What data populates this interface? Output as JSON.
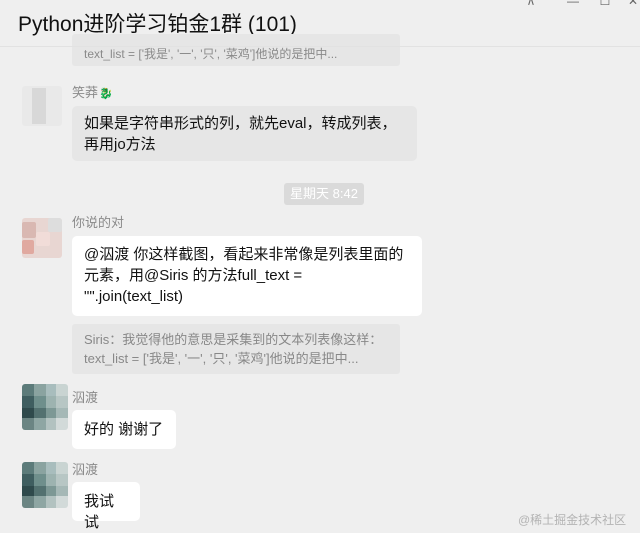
{
  "window": {
    "title": "Python进阶学习铂金1群 (101)",
    "controls": {
      "pin": "⊼",
      "minimize": "—",
      "maximize": "☐",
      "close": "✕"
    }
  },
  "messages": [
    {
      "type": "quote_partial",
      "text": "text_list = ['我是', '一', '只', '菜鸡']他说的是把中..."
    },
    {
      "sender": "笑莽",
      "sender_badge": "🐉",
      "lines": [
        "如果是字符串形式的列，就先eval，转成列表，",
        "再用jo方法"
      ]
    },
    {
      "type": "timestamp",
      "text": "星期天 8:42"
    },
    {
      "sender": "你说的对",
      "lines": [
        "@泅渡 你这样截图，看起来非常像是列表里面的",
        "元素，用@Siris 的方法full_text =",
        "\"\".join(text_list)"
      ],
      "quote_lines": [
        "Siris：我觉得他的意思是采集到的文本列表像这样：",
        "text_list = ['我是', '一', '只', '菜鸡']他说的是把中..."
      ]
    },
    {
      "sender": "泅渡",
      "lines": [
        "好的 谢谢了"
      ]
    },
    {
      "sender": "泅渡",
      "lines": [
        "我试试"
      ]
    }
  ],
  "watermark": "@稀土掘金技术社区",
  "colors": {
    "background": "#efefef",
    "bubble_white": "#ffffff",
    "bubble_gray": "#e6e6e6",
    "meta_text": "#8a8a8a"
  }
}
